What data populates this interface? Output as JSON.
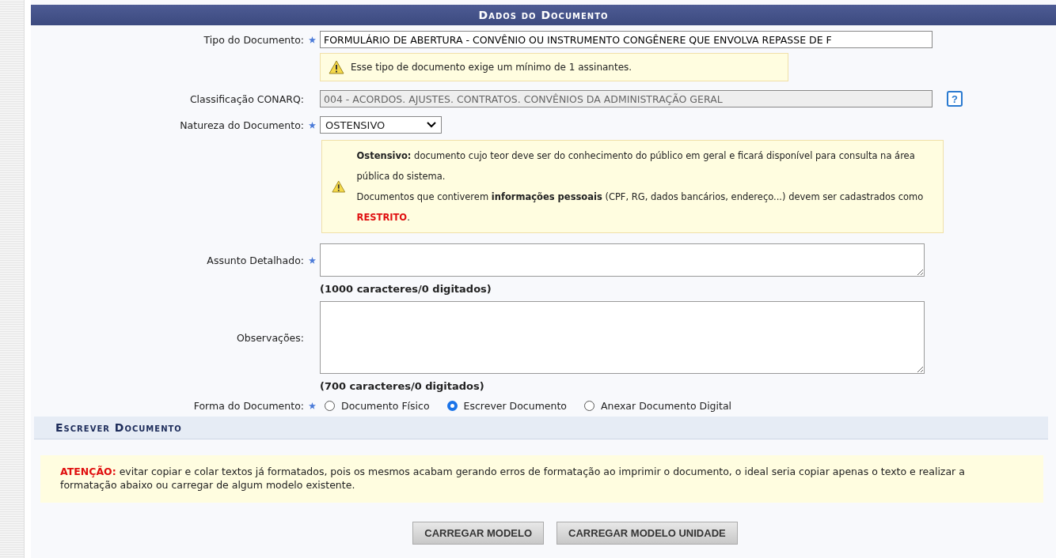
{
  "section_title": "Dados do Documento",
  "tipo": {
    "label": "Tipo do Documento:",
    "required": true,
    "value": "FORMULÁRIO DE ABERTURA - CONVÊNIO OU INSTRUMENTO CONGÊNERE QUE ENVOLVA REPASSE DE F"
  },
  "signers_warning": "Esse tipo de documento exige um mínimo de 1 assinantes.",
  "classificacao": {
    "label": "Classificação CONARQ:",
    "required": false,
    "value": "004 - ACORDOS. AJUSTES. CONTRATOS. CONVÊNIOS DA ADMINISTRAÇÃO GERAL",
    "help": "?"
  },
  "natureza": {
    "label": "Natureza do Documento:",
    "required": true,
    "value": "OSTENSIVO"
  },
  "natureza_info": [
    [
      {
        "text": "Ostensivo:",
        "kind": "bold"
      },
      {
        "text": " documento cujo teor deve ser do conhecimento do público em geral e ficará disponível para consulta na área pública do sistema.",
        "kind": "plain"
      }
    ],
    [
      {
        "text": "Documentos que contiverem ",
        "kind": "plain"
      },
      {
        "text": "informações pessoais",
        "kind": "bold"
      },
      {
        "text": " (CPF, RG, dados bancários, endereço...) devem ser cadastrados como ",
        "kind": "plain"
      },
      {
        "text": "RESTRITO",
        "kind": "alert"
      },
      {
        "text": ".",
        "kind": "plain"
      }
    ]
  ],
  "assunto": {
    "label": "Assunto Detalhado:",
    "required": true,
    "counter": "(1000 caracteres/0 digitados)"
  },
  "observacoes": {
    "label": "Observações:",
    "required": false,
    "counter": "(700 caracteres/0 digitados)"
  },
  "forma": {
    "label": "Forma do Documento:",
    "required": true,
    "options": [
      {
        "label": "Documento Físico",
        "selected": false
      },
      {
        "label": "Escrever Documento",
        "selected": true
      },
      {
        "label": "Anexar Documento Digital",
        "selected": false
      }
    ]
  },
  "subsection_title": "Escrever Documento",
  "attention": [
    {
      "text": "ATENÇÃO:",
      "kind": "alert"
    },
    {
      "text": " evitar copiar e colar textos já formatados, pois os mesmos acabam gerando erros de formatação ao imprimir o documento, o ideal seria copiar apenas o texto e realizar a formatação abaixo ou carregar de algum modelo existente.",
      "kind": "plain"
    }
  ],
  "buttons": [
    "CARREGAR MODELO",
    "CARREGAR MODELO UNIDADE"
  ]
}
